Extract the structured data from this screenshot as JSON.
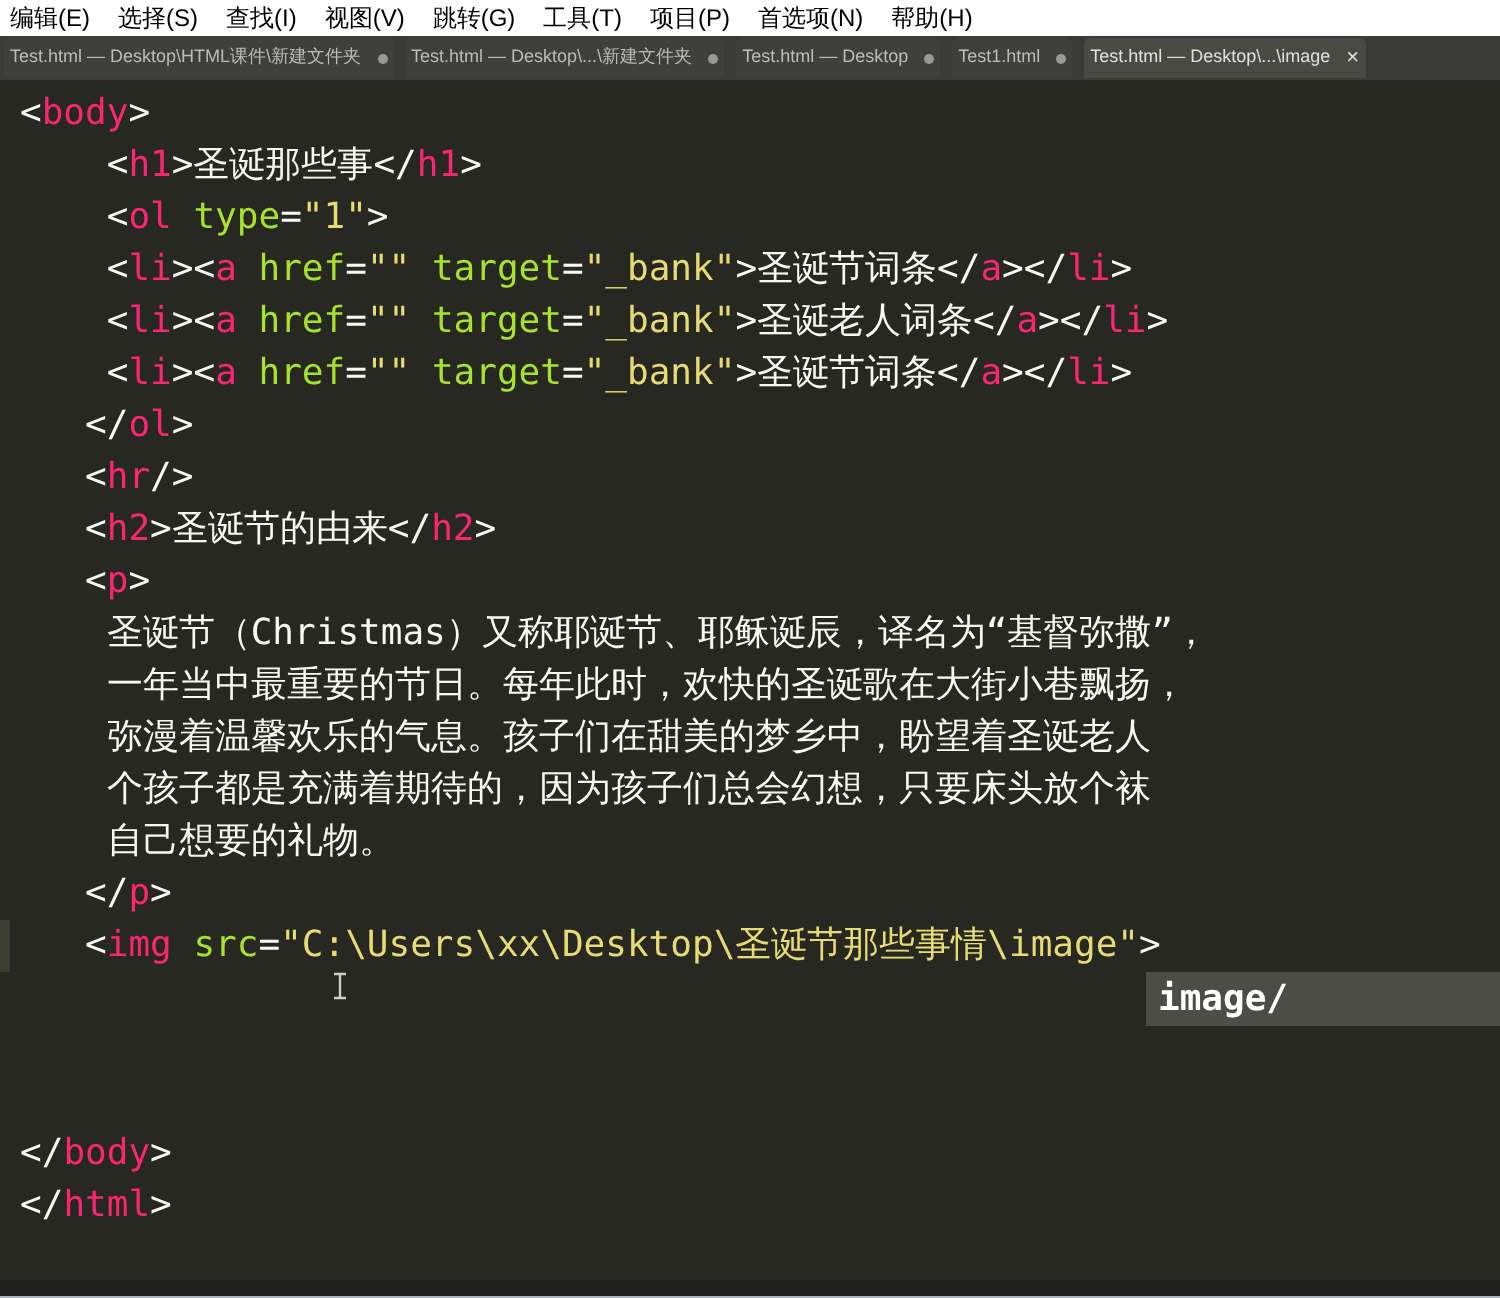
{
  "menu": [
    "编辑(E)",
    "选择(S)",
    "查找(I)",
    "视图(V)",
    "跳转(G)",
    "工具(T)",
    "项目(P)",
    "首选项(N)",
    "帮助(H)"
  ],
  "tabs": [
    {
      "label": "Test.html — Desktop\\HTML课件\\新建文件夹",
      "selected": false,
      "modified": true
    },
    {
      "label": "Test.html — Desktop\\...\\新建文件夹",
      "selected": false,
      "modified": true
    },
    {
      "label": "Test.html — Desktop",
      "selected": false,
      "modified": true
    },
    {
      "label": "Test1.html",
      "selected": false,
      "modified": true
    },
    {
      "label": "Test.html — Desktop\\...\\image",
      "selected": true,
      "modified": false,
      "close": "×"
    }
  ],
  "code_top": [
    {
      "current": false,
      "tokens": [
        {
          "kind": "punct",
          "t": "<"
        },
        {
          "kind": "tag",
          "t": "body"
        },
        {
          "kind": "punct",
          "t": ">"
        }
      ]
    },
    {
      "current": false,
      "tokens": [
        {
          "kind": "punct",
          "t": "    <"
        },
        {
          "kind": "tag",
          "t": "h1"
        },
        {
          "kind": "punct",
          "t": ">圣诞那些事</"
        },
        {
          "kind": "tag",
          "t": "h1"
        },
        {
          "kind": "punct",
          "t": ">"
        }
      ]
    },
    {
      "current": false,
      "tokens": [
        {
          "kind": "punct",
          "t": "    <"
        },
        {
          "kind": "tag",
          "t": "ol"
        },
        {
          "kind": "attr",
          "t": " type"
        },
        {
          "kind": "punct",
          "t": "="
        },
        {
          "kind": "str",
          "t": "\"1\""
        },
        {
          "kind": "punct",
          "t": ">"
        }
      ]
    },
    {
      "current": false,
      "tokens": [
        {
          "kind": "punct",
          "t": "    <"
        },
        {
          "kind": "tag",
          "t": "li"
        },
        {
          "kind": "punct",
          "t": "><"
        },
        {
          "kind": "tag",
          "t": "a"
        },
        {
          "kind": "attr",
          "t": " href"
        },
        {
          "kind": "punct",
          "t": "="
        },
        {
          "kind": "str",
          "t": "\"\""
        },
        {
          "kind": "attr",
          "t": " target"
        },
        {
          "kind": "punct",
          "t": "="
        },
        {
          "kind": "str",
          "t": "\"_bank\""
        },
        {
          "kind": "punct",
          "t": ">圣诞节词条</"
        },
        {
          "kind": "tag",
          "t": "a"
        },
        {
          "kind": "punct",
          "t": "></"
        },
        {
          "kind": "tag",
          "t": "li"
        },
        {
          "kind": "punct",
          "t": ">"
        }
      ]
    },
    {
      "current": false,
      "tokens": [
        {
          "kind": "punct",
          "t": "    <"
        },
        {
          "kind": "tag",
          "t": "li"
        },
        {
          "kind": "punct",
          "t": "><"
        },
        {
          "kind": "tag",
          "t": "a"
        },
        {
          "kind": "attr",
          "t": " href"
        },
        {
          "kind": "punct",
          "t": "="
        },
        {
          "kind": "str",
          "t": "\"\""
        },
        {
          "kind": "attr",
          "t": " target"
        },
        {
          "kind": "punct",
          "t": "="
        },
        {
          "kind": "str",
          "t": "\"_bank\""
        },
        {
          "kind": "punct",
          "t": ">圣诞老人词条</"
        },
        {
          "kind": "tag",
          "t": "a"
        },
        {
          "kind": "punct",
          "t": "></"
        },
        {
          "kind": "tag",
          "t": "li"
        },
        {
          "kind": "punct",
          "t": ">"
        }
      ]
    },
    {
      "current": false,
      "tokens": [
        {
          "kind": "punct",
          "t": "    <"
        },
        {
          "kind": "tag",
          "t": "li"
        },
        {
          "kind": "punct",
          "t": "><"
        },
        {
          "kind": "tag",
          "t": "a"
        },
        {
          "kind": "attr",
          "t": " href"
        },
        {
          "kind": "punct",
          "t": "="
        },
        {
          "kind": "str",
          "t": "\"\""
        },
        {
          "kind": "attr",
          "t": " target"
        },
        {
          "kind": "punct",
          "t": "="
        },
        {
          "kind": "str",
          "t": "\"_bank\""
        },
        {
          "kind": "punct",
          "t": ">圣诞节词条</"
        },
        {
          "kind": "tag",
          "t": "a"
        },
        {
          "kind": "punct",
          "t": "></"
        },
        {
          "kind": "tag",
          "t": "li"
        },
        {
          "kind": "punct",
          "t": ">"
        }
      ]
    },
    {
      "current": false,
      "tokens": [
        {
          "kind": "punct",
          "t": "   </"
        },
        {
          "kind": "tag",
          "t": "ol"
        },
        {
          "kind": "punct",
          "t": ">"
        }
      ]
    },
    {
      "current": false,
      "tokens": [
        {
          "kind": "punct",
          "t": "   <"
        },
        {
          "kind": "tag",
          "t": "hr"
        },
        {
          "kind": "punct",
          "t": "/>"
        }
      ]
    },
    {
      "current": false,
      "tokens": [
        {
          "kind": "punct",
          "t": "   <"
        },
        {
          "kind": "tag",
          "t": "h2"
        },
        {
          "kind": "punct",
          "t": ">圣诞节的由来</"
        },
        {
          "kind": "tag",
          "t": "h2"
        },
        {
          "kind": "punct",
          "t": ">"
        }
      ]
    },
    {
      "current": false,
      "tokens": [
        {
          "kind": "punct",
          "t": "   <"
        },
        {
          "kind": "tag",
          "t": "p"
        },
        {
          "kind": "punct",
          "t": ">"
        }
      ]
    },
    {
      "current": false,
      "tokens": [
        {
          "kind": "punct",
          "t": "    圣诞节（Christmas）又称耶诞节、耶稣诞辰，译名为“基督弥撒”，"
        }
      ]
    },
    {
      "current": false,
      "tokens": [
        {
          "kind": "punct",
          "t": "    一年当中最重要的节日。每年此时，欢快的圣诞歌在大街小巷飘扬，"
        }
      ]
    },
    {
      "current": false,
      "tokens": [
        {
          "kind": "punct",
          "t": "    弥漫着温馨欢乐的气息。孩子们在甜美的梦乡中，盼望着圣诞老人"
        }
      ]
    },
    {
      "current": false,
      "tokens": [
        {
          "kind": "punct",
          "t": "    个孩子都是充满着期待的，因为孩子们总会幻想，只要床头放个袜"
        }
      ]
    },
    {
      "current": false,
      "tokens": [
        {
          "kind": "punct",
          "t": "    自己想要的礼物。"
        }
      ]
    },
    {
      "current": false,
      "tokens": [
        {
          "kind": "punct",
          "t": "   </"
        },
        {
          "kind": "tag",
          "t": "p"
        },
        {
          "kind": "punct",
          "t": ">"
        }
      ]
    },
    {
      "current": true,
      "tokens": [
        {
          "kind": "punct",
          "t": "   <"
        },
        {
          "kind": "tag",
          "t": "img"
        },
        {
          "kind": "attr",
          "t": " src"
        },
        {
          "kind": "punct",
          "t": "="
        },
        {
          "kind": "str",
          "t": "\"C:\\Users\\xx\\Desktop\\圣诞节那些事情\\image\""
        },
        {
          "kind": "punct",
          "t": ">"
        }
      ]
    }
  ],
  "autocomplete": "image/",
  "code_bottom": [
    {
      "current": false,
      "tokens": [
        {
          "kind": "punct",
          "t": "</"
        },
        {
          "kind": "tag",
          "t": "body"
        },
        {
          "kind": "punct",
          "t": ">"
        }
      ]
    },
    {
      "current": false,
      "tokens": [
        {
          "kind": "punct",
          "t": "</"
        },
        {
          "kind": "tag",
          "t": "html"
        },
        {
          "kind": "punct",
          "t": ">"
        }
      ]
    }
  ]
}
